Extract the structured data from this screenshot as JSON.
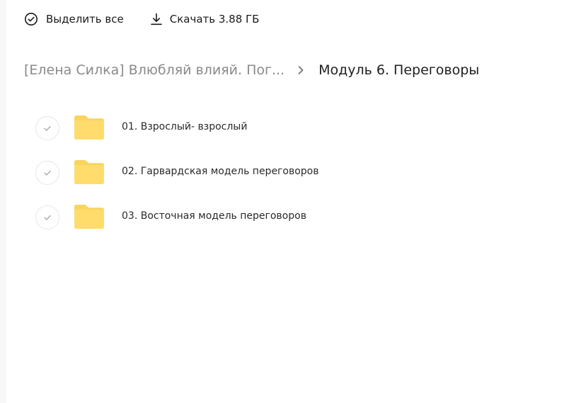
{
  "toolbar": {
    "select_all_label": "Выделить все",
    "select_all_icon": "check-circle-icon",
    "download_label": "Скачать 3.88 ГБ",
    "download_icon": "download-icon"
  },
  "breadcrumb": {
    "parent": "[Елена Силка] Влюбляй влияй. Пог...",
    "separator_icon": "chevron-right-icon",
    "current": "Модуль 6. Переговоры"
  },
  "files": [
    {
      "name": "01. Взрослый- взрослый",
      "type": "folder",
      "icon": "folder-icon"
    },
    {
      "name": "02. Гарвардская модель переговоров",
      "type": "folder",
      "icon": "folder-icon"
    },
    {
      "name": "03. Восточная модель переговоров",
      "type": "folder",
      "icon": "folder-icon"
    }
  ],
  "colors": {
    "folder": "#FFDC6B",
    "folder_tab": "#F9D45F",
    "check_border": "#E7E7E7",
    "check_mark": "#A9A9A9",
    "breadcrumb_parent": "#8A8A8A",
    "text": "#1F1F1F",
    "side_strip": "#F6F7F9"
  }
}
